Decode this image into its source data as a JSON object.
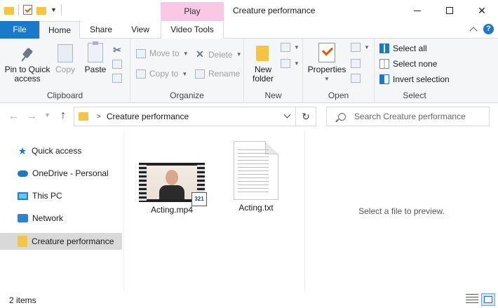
{
  "titlebar": {
    "window_title": "Creature performance",
    "context_tab": "Play"
  },
  "tabs": {
    "file": "File",
    "home": "Home",
    "share": "Share",
    "view": "View",
    "video_tools": "Video Tools",
    "help": "?"
  },
  "ribbon": {
    "clipboard": {
      "label": "Clipboard",
      "pin": "Pin to Quick access",
      "copy": "Copy",
      "paste": "Paste"
    },
    "organize": {
      "label": "Organize",
      "move_to": "Move to",
      "copy_to": "Copy to",
      "delete": "Delete",
      "rename": "Rename"
    },
    "new": {
      "label": "New",
      "new_folder": "New folder"
    },
    "open": {
      "label": "Open",
      "properties": "Properties"
    },
    "select": {
      "label": "Select",
      "select_all": "Select all",
      "select_none": "Select none",
      "invert_selection": "Invert selection"
    }
  },
  "address": {
    "path": "Creature performance",
    "search_placeholder": "Search Creature performance"
  },
  "nav": {
    "items": [
      {
        "label": "Quick access",
        "icon": "star-icon"
      },
      {
        "label": "OneDrive - Personal",
        "icon": "cloud-icon"
      },
      {
        "label": "This PC",
        "icon": "computer-icon"
      },
      {
        "label": "Network",
        "icon": "network-icon"
      },
      {
        "label": "Creature performance",
        "icon": "folder-icon",
        "selected": true
      }
    ]
  },
  "files": [
    {
      "name": "Acting.mp4",
      "type": "video",
      "badge": "321"
    },
    {
      "name": "Acting.txt",
      "type": "text"
    }
  ],
  "preview": {
    "message": "Select a file to preview."
  },
  "status": {
    "item_count": "2 items"
  },
  "colors": {
    "accent": "#1979ca",
    "context_tab": "#f8c8e4",
    "folder": "#f5c542",
    "selected_nav": "#d9d9d9"
  }
}
